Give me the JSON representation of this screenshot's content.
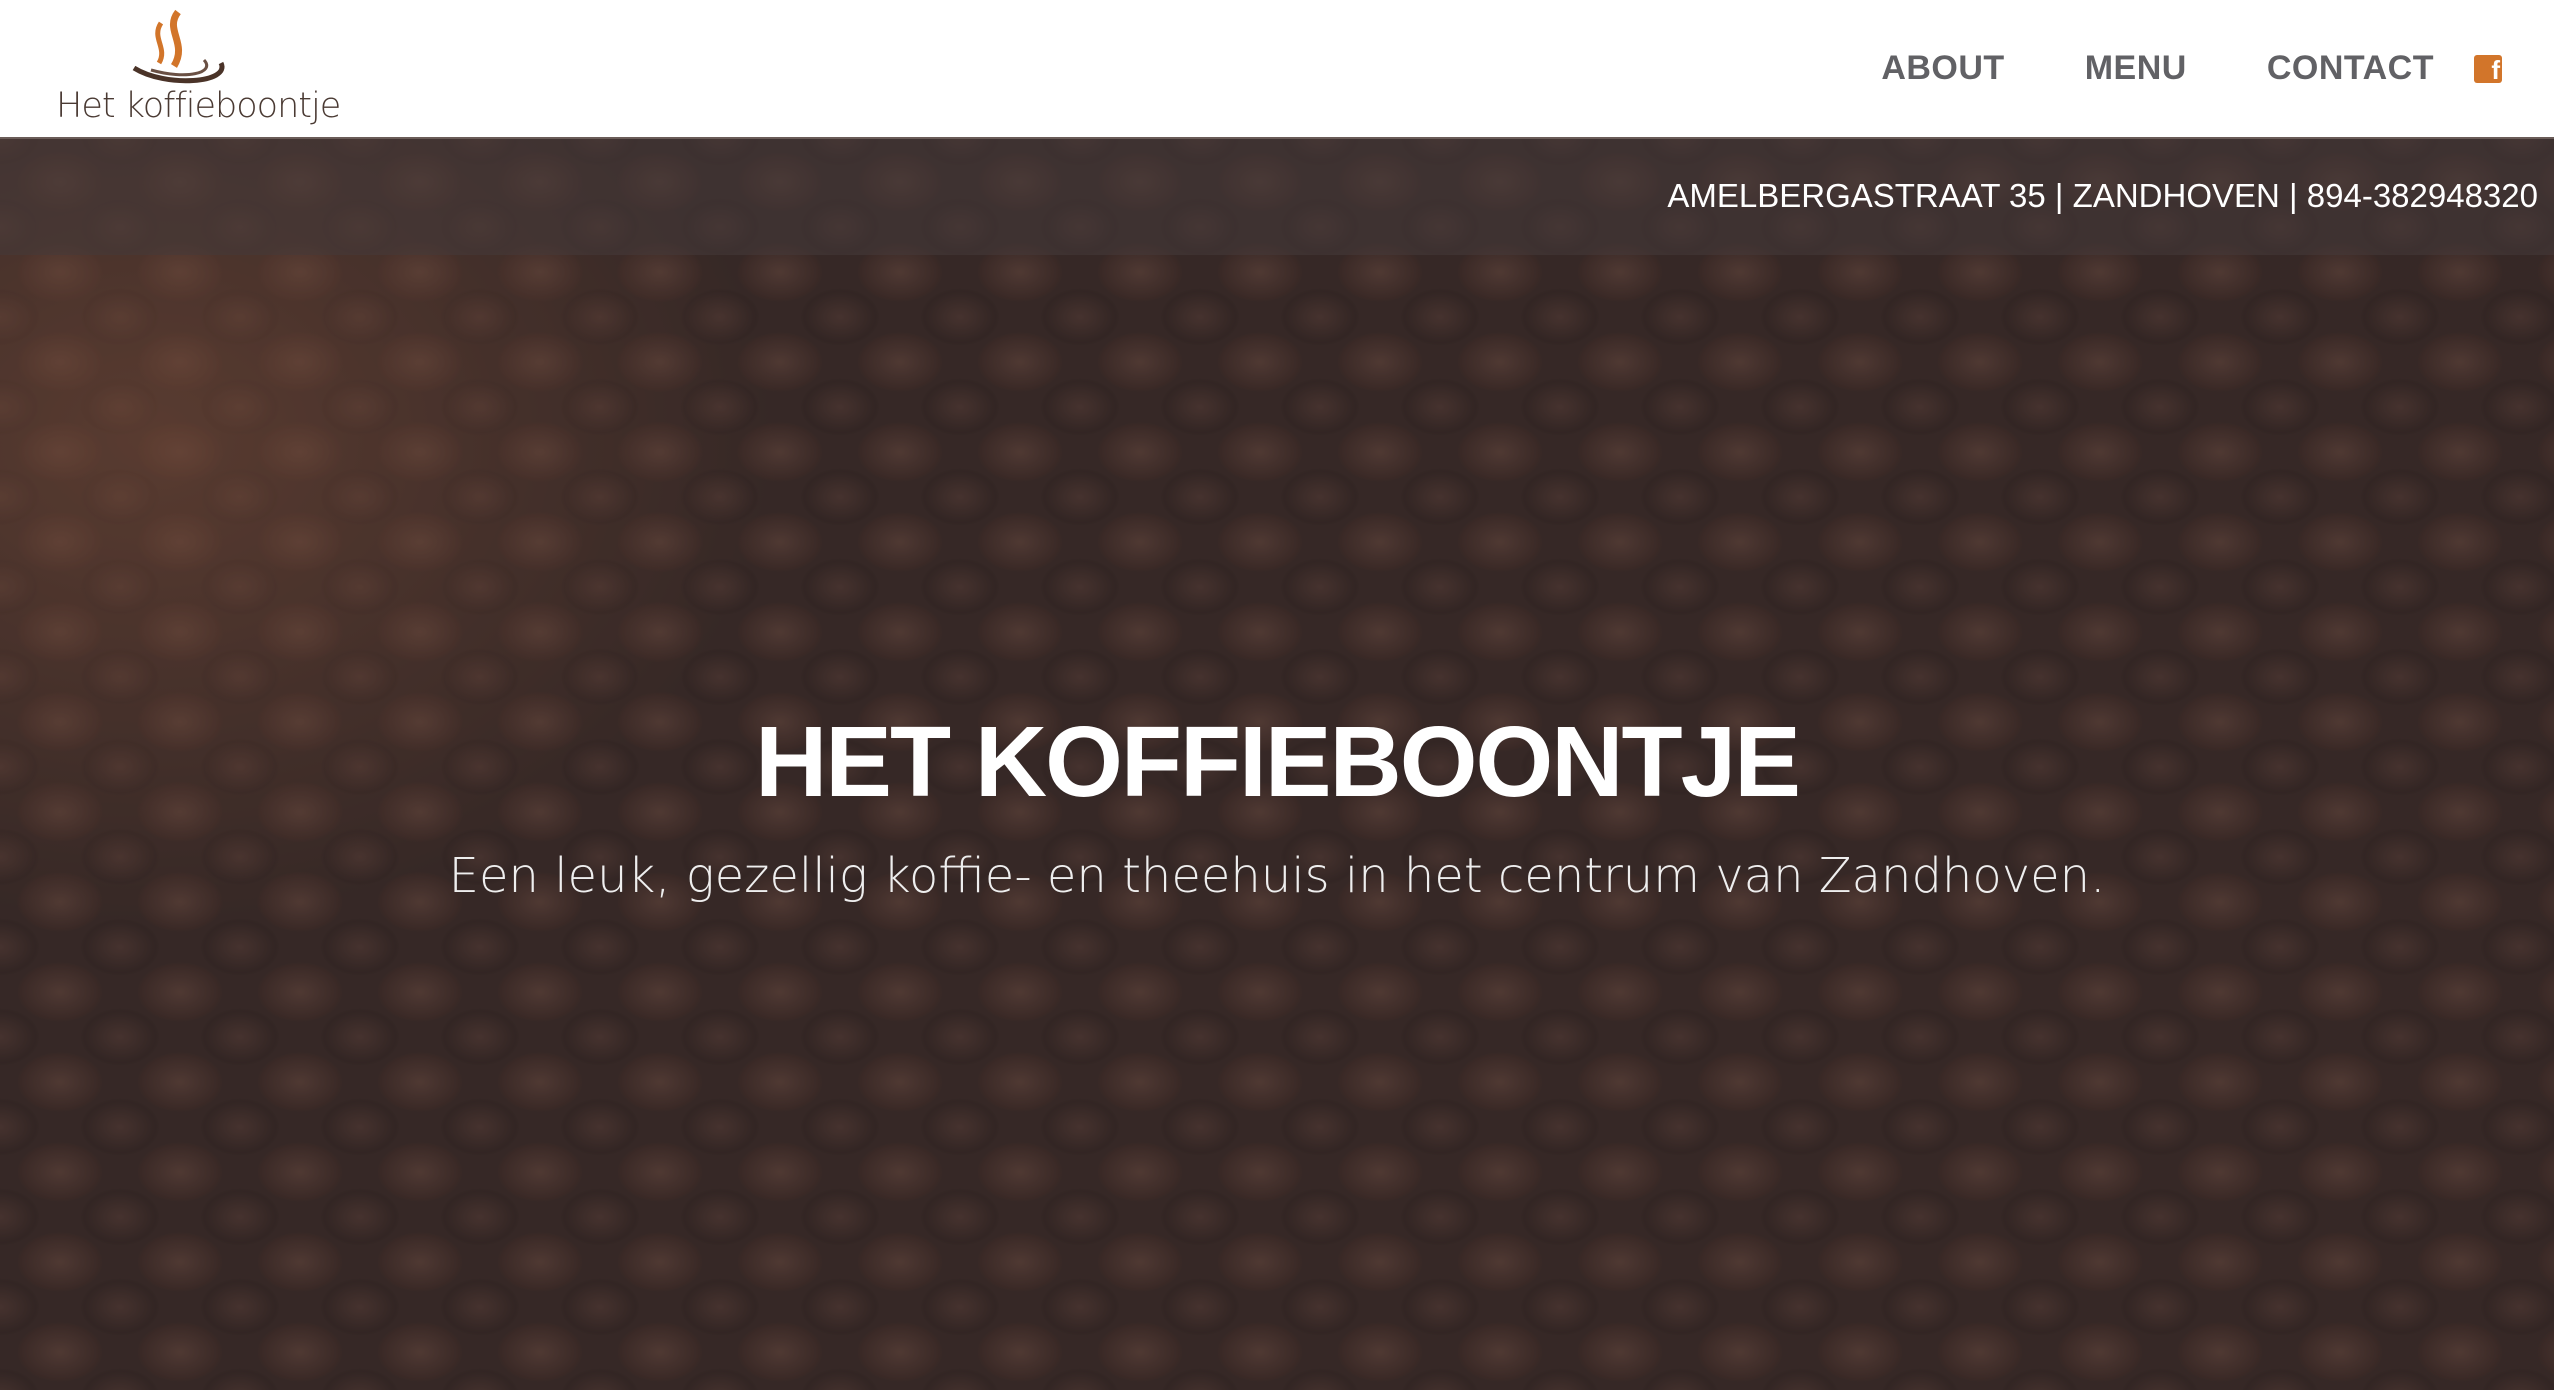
{
  "header": {
    "logo_text": "Het koffieboontje",
    "nav": [
      {
        "label": "ABOUT"
      },
      {
        "label": "MENU"
      },
      {
        "label": "CONTACT"
      }
    ],
    "facebook_icon": "facebook-icon",
    "facebook_glyph": "f"
  },
  "hero": {
    "address": "AMELBERGASTRAAT 35 | ZANDHOVEN | 894-382948320",
    "title": "HET KOFFIEBOONTJE",
    "subtitle": "Een leuk, gezellig koffie- en theehuis in het centrum van Zandhoven."
  },
  "colors": {
    "accent": "#d2752a",
    "nav_text": "#616165",
    "logo_brown": "#4a3a33"
  }
}
